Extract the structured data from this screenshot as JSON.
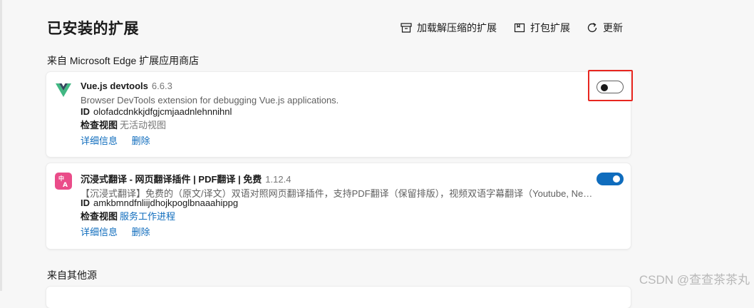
{
  "header": {
    "title": "已安装的扩展",
    "load_unpacked_label": "加载解压缩的扩展",
    "pack_label": "打包扩展",
    "update_label": "更新"
  },
  "sections": {
    "store_title": "来自 Microsoft Edge 扩展应用商店",
    "other_title": "来自其他源"
  },
  "extensions": [
    {
      "name": "Vue.js devtools",
      "version": "6.6.3",
      "description": "Browser DevTools extension for debugging Vue.js applications.",
      "id_label": "ID",
      "id_value": "olofadcdnkkjdfgjcmjaadnlehnnihnl",
      "inspect_label": "检查视图",
      "inspect_value": "无活动视图",
      "details_label": "详细信息",
      "remove_label": "删除",
      "enabled": false,
      "icon": "vue-logo-icon"
    },
    {
      "name": "沉浸式翻译 - 网页翻译插件 | PDF翻译 | 免费",
      "version": "1.12.4",
      "description": "【沉浸式翻译】免费的（原文/译文）双语对照网页翻译插件，支持PDF翻译（保留排版），视频双语字幕翻译（Youtube, Netflix）, ...",
      "id_label": "ID",
      "id_value": "amkbmndfnliijdhojkpoglbnaaahippg",
      "inspect_label": "检查视图",
      "inspect_value": "服务工作进程",
      "details_label": "详细信息",
      "remove_label": "删除",
      "enabled": true,
      "icon": "immersive-translate-icon"
    }
  ],
  "watermark": "CSDN @查查茶茶丸",
  "colors": {
    "accent": "#0f6cbd",
    "highlight": "#e8261f",
    "background": "#f7f7f7"
  }
}
